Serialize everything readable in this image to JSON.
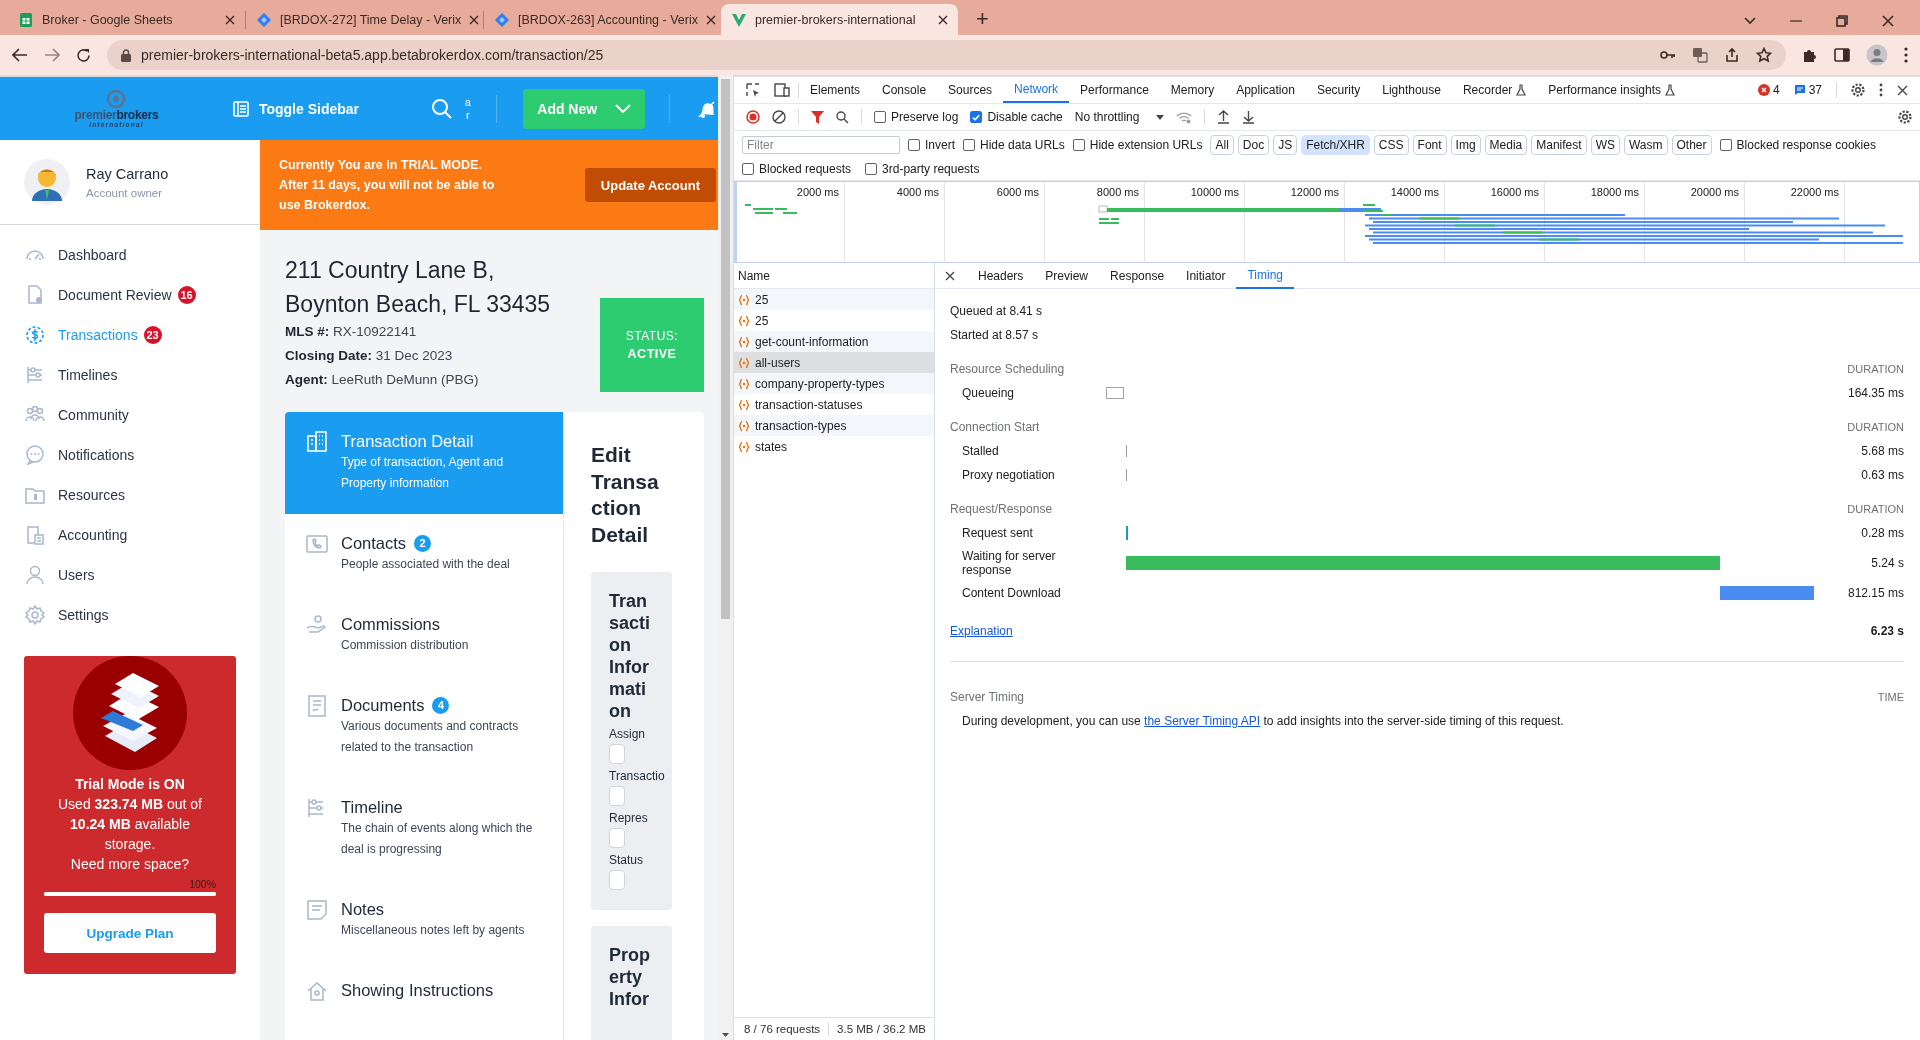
{
  "browser": {
    "tabs": [
      {
        "title": "Broker - Google Sheets",
        "selected": false
      },
      {
        "title": "[BRDOX-272] Time Delay - Verix",
        "selected": false
      },
      {
        "title": "[BRDOX-263] Accounting - Verix",
        "selected": false
      },
      {
        "title": "premier-brokers-international",
        "selected": true
      }
    ],
    "new_tab": "+",
    "url": "premier-brokers-international-beta5.app.betabrokerdox.com/transaction/25"
  },
  "app": {
    "logo": {
      "word1": "premier",
      "word2": "brokers",
      "tagline": "international"
    },
    "header": {
      "toggle": "Toggle Sidebar",
      "search_cut": "ar",
      "add_new": "Add New"
    },
    "user": {
      "name": "Ray Carrano",
      "role": "Account owner"
    },
    "nav": [
      {
        "label": "Dashboard",
        "selected": false
      },
      {
        "label": "Document Review",
        "badge": "16",
        "selected": false
      },
      {
        "label": "Transactions",
        "badge": "23",
        "selected": true
      },
      {
        "label": "Timelines",
        "selected": false
      },
      {
        "label": "Community",
        "selected": false
      },
      {
        "label": "Notifications",
        "selected": false
      },
      {
        "label": "Resources",
        "selected": false
      },
      {
        "label": "Accounting",
        "selected": false
      },
      {
        "label": "Users",
        "selected": false
      },
      {
        "label": "Settings",
        "selected": false
      }
    ],
    "trial": {
      "title": "Trial Mode is ON",
      "usage": "Used **323.74 MB** out of **10.24 MB** available storage.",
      "question": "Need more space?",
      "percent": "100%",
      "level": 1,
      "button": "Upgrade Plan"
    },
    "banner": {
      "text": "Currently You are in TRIAL MODE. After 11 days, you will not be able to use Brokerdox.",
      "button": "Update Account"
    },
    "property": {
      "address": [
        "211 Country Lane B,",
        "Boynton Beach, FL 33435"
      ],
      "details": [
        {
          "label": "MLS #:",
          "value": "RX-10922141"
        },
        {
          "label": "Closing Date:",
          "value": "31 Dec 2023"
        },
        {
          "label": "Agent:",
          "value": "LeeRuth DeMunn (PBG)"
        }
      ],
      "status": {
        "label": "STATUS:",
        "value": "ACTIVE"
      }
    },
    "sections": [
      {
        "title": "Transaction Detail",
        "description": "Type of transaction, Agent and Property information",
        "selected": true
      },
      {
        "title": "Contacts",
        "badge": "2",
        "description": "People associated with the deal",
        "selected": false
      },
      {
        "title": "Commissions",
        "description": "Commission distribution",
        "selected": false
      },
      {
        "title": "Documents",
        "badge": "4",
        "description": "Various documents and contracts related to the transaction",
        "selected": false
      },
      {
        "title": "Timeline",
        "description": "The chain of events along which the deal is progressing",
        "selected": false
      },
      {
        "title": "Notes",
        "description": "Miscellaneous notes left by agents",
        "selected": false
      },
      {
        "title": "Showing Instructions",
        "selected": false
      }
    ],
    "edit": {
      "title": "Edit Transaction Detail",
      "cards": [
        {
          "title": "Transaction Information",
          "fields": [
            {
              "label": "Assign"
            },
            {
              "label": "Transactio"
            },
            {
              "label": "Repres"
            },
            {
              "label": "Status"
            }
          ]
        },
        {
          "title": "Property Infor"
        }
      ]
    }
  },
  "devtools": {
    "tabs": [
      {
        "label": "Elements",
        "kind": "panel",
        "selected": false
      },
      {
        "label": "Console",
        "kind": "panel",
        "selected": false
      },
      {
        "label": "Sources",
        "kind": "panel",
        "selected": false
      },
      {
        "label": "Network",
        "kind": "panel",
        "selected": true
      },
      {
        "label": "Performance",
        "kind": "panel",
        "selected": false
      },
      {
        "label": "Memory",
        "kind": "panel",
        "selected": false
      },
      {
        "label": "Application",
        "kind": "panel",
        "selected": false
      },
      {
        "label": "Security",
        "kind": "panel",
        "selected": false
      },
      {
        "label": "Lighthouse",
        "kind": "panel",
        "selected": false
      },
      {
        "label": "Recorder",
        "kind": "experimental",
        "selected": false
      },
      {
        "label": "Performance insights",
        "kind": "experimental",
        "selected": false
      }
    ],
    "errors": "4",
    "messages": "37",
    "toolbar": {
      "checkboxes": [
        {
          "label": "Preserve log",
          "checked": false
        },
        {
          "label": "Disable cache",
          "checked": true
        }
      ],
      "throttling": "No throttling"
    },
    "filter": {
      "placeholder": "Filter",
      "options": [
        {
          "label": "Invert",
          "checked": false
        },
        {
          "label": "Hide data URLs",
          "checked": false
        },
        {
          "label": "Hide extension URLs",
          "checked": false
        }
      ],
      "types": [
        {
          "label": "All",
          "selected": false
        },
        {
          "label": "Doc",
          "selected": false
        },
        {
          "label": "JS",
          "selected": false
        },
        {
          "label": "Fetch/XHR",
          "selected": true
        },
        {
          "label": "CSS",
          "selected": false
        },
        {
          "label": "Font",
          "selected": false
        },
        {
          "label": "Img",
          "selected": false
        },
        {
          "label": "Media",
          "selected": false
        },
        {
          "label": "Manifest",
          "selected": false
        },
        {
          "label": "WS",
          "selected": false
        },
        {
          "label": "Wasm",
          "selected": false
        },
        {
          "label": "Other",
          "selected": false
        }
      ],
      "blocked_cookies": {
        "label": "Blocked response cookies",
        "checked": false
      },
      "more": [
        {
          "label": "Blocked requests",
          "checked": false
        },
        {
          "label": "3rd-party requests",
          "checked": false
        }
      ]
    },
    "overview": {
      "ticks": [
        "2000 ms",
        "4000 ms",
        "6000 ms",
        "8000 ms",
        "10000 ms",
        "12000 ms",
        "14000 ms",
        "16000 ms",
        "18000 ms",
        "20000 ms",
        "22000 ms"
      ]
    },
    "requests": {
      "header": "Name",
      "items": [
        {
          "name": "25",
          "selected": false
        },
        {
          "name": "25",
          "selected": false
        },
        {
          "name": "get-count-information",
          "selected": false
        },
        {
          "name": "all-users",
          "selected": true
        },
        {
          "name": "company-property-types",
          "selected": false
        },
        {
          "name": "transaction-statuses",
          "selected": false
        },
        {
          "name": "transaction-types",
          "selected": false
        },
        {
          "name": "states",
          "selected": false
        }
      ]
    },
    "detail": {
      "tabs": [
        {
          "label": "Headers",
          "selected": false
        },
        {
          "label": "Preview",
          "selected": false
        },
        {
          "label": "Response",
          "selected": false
        },
        {
          "label": "Initiator",
          "selected": false
        },
        {
          "label": "Timing",
          "selected": true
        }
      ],
      "queued": "Queued at 8.41 s",
      "started": "Started at 8.57 s",
      "sections": [
        {
          "title": "Resource Scheduling",
          "column": "DURATION",
          "rows": [
            {
              "label": "Queueing",
              "kind": "box",
              "value": "164.35 ms"
            }
          ]
        },
        {
          "title": "Connection Start",
          "column": "DURATION",
          "rows": [
            {
              "label": "Stalled",
              "kind": "tick",
              "color": "#9e9e9e",
              "value": "5.68 ms"
            },
            {
              "label": "Proxy negotiation",
              "kind": "tick",
              "color": "#9e9e9e",
              "value": "0.63 ms"
            }
          ]
        },
        {
          "title": "Request/Response",
          "column": "DURATION",
          "rows": [
            {
              "label": "Request sent",
              "kind": "tick",
              "color": "#1a9bb8",
              "value": "0.28 ms"
            },
            {
              "label": "Waiting for server response",
              "kind": "bar",
              "color": "#37bb5c",
              "value": "5.24 s"
            },
            {
              "label": "Content Download",
              "kind": "bar",
              "color": "#4a8cf0",
              "value": "812.15 ms"
            }
          ]
        }
      ],
      "explanation": "Explanation",
      "total": "6.23 s",
      "server_timing": {
        "title": "Server Timing",
        "column": "TIME",
        "text_before": "During development, you can use ",
        "link": "the Server Timing API",
        "text_after": " to add insights into the server-side timing of this request."
      }
    },
    "footer": [
      "8 / 76 requests",
      "3.5 MB / 36.2 MB"
    ]
  }
}
